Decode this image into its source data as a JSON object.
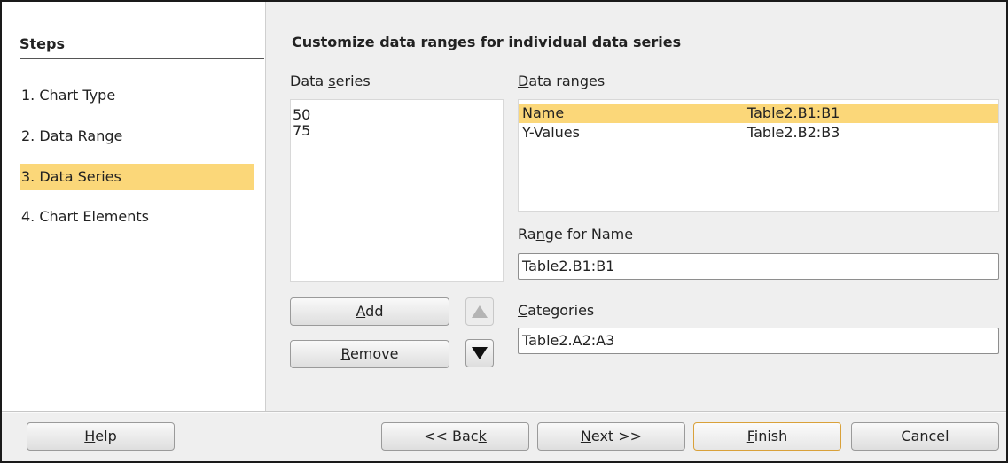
{
  "sidebar": {
    "title": "Steps",
    "items": [
      {
        "label": "1. Chart Type",
        "active": false
      },
      {
        "label": "2. Data Range",
        "active": false
      },
      {
        "label": "3. Data Series",
        "active": true
      },
      {
        "label": "4. Chart Elements",
        "active": false
      }
    ]
  },
  "main": {
    "title": "Customize data ranges for individual data series",
    "data_series": {
      "label_pre": "Data ",
      "label_mnemonic": "s",
      "label_post": "eries",
      "items": [
        "50",
        "75"
      ]
    },
    "data_ranges": {
      "label_mnemonic": "D",
      "label_post": "ata ranges",
      "rows": [
        {
          "name": "Name",
          "range": "Table2.B1:B1",
          "selected": true
        },
        {
          "name": "Y-Values",
          "range": "Table2.B2:B3",
          "selected": false
        }
      ]
    },
    "range_for_name": {
      "label_pre": "Ra",
      "label_mnemonic": "n",
      "label_post": "ge for Name",
      "value": "Table2.B1:B1"
    },
    "categories": {
      "label_mnemonic": "C",
      "label_post": "ategories",
      "value": "Table2.A2:A3"
    },
    "add_button": {
      "mnemonic": "A",
      "post": "dd"
    },
    "remove_button": {
      "mnemonic": "R",
      "post": "emove"
    }
  },
  "footer": {
    "help": {
      "mnemonic": "H",
      "post": "elp"
    },
    "back": {
      "pre": "<< Bac",
      "mnemonic": "k",
      "post": ""
    },
    "next": {
      "mnemonic": "N",
      "post": "ext >>"
    },
    "finish": {
      "mnemonic": "F",
      "post": "inish"
    },
    "cancel": "Cancel"
  },
  "colors": {
    "selection": "#fbd779",
    "focus_border": "#d9a13a"
  }
}
